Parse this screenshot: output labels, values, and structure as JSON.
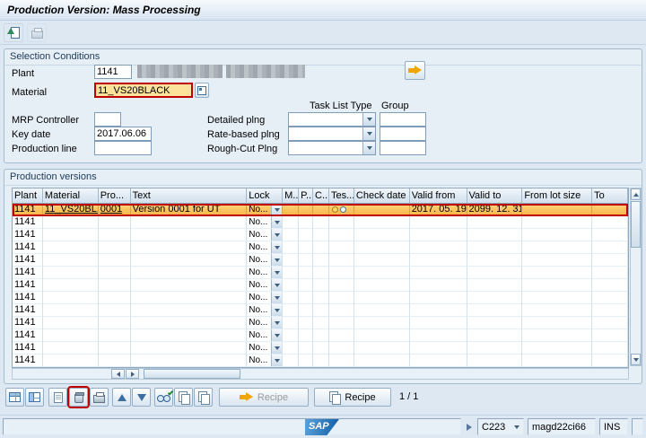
{
  "window": {
    "title": "Production Version: Mass Processing"
  },
  "selection": {
    "title": "Selection Conditions",
    "plant": {
      "label": "Plant",
      "value": "1141"
    },
    "material": {
      "label": "Material",
      "value": "11_VS20BLACK"
    },
    "col_headers": {
      "task_list_type": "Task List Type",
      "group": "Group"
    },
    "mrp": {
      "label": "MRP Controller"
    },
    "detailed": {
      "label": "Detailed plng"
    },
    "key_date": {
      "label": "Key date",
      "value": "2017.06.06"
    },
    "rate": {
      "label": "Rate-based plng"
    },
    "prod_line": {
      "label": "Production line"
    },
    "rough": {
      "label": "Rough-Cut Plng"
    }
  },
  "versions": {
    "title": "Production versions",
    "lock_display": "No...",
    "columns": [
      {
        "key": "plant",
        "label": "Plant"
      },
      {
        "key": "material",
        "label": "Material"
      },
      {
        "key": "pro",
        "label": "Pro..."
      },
      {
        "key": "text",
        "label": "Text"
      },
      {
        "key": "lock",
        "label": "Lock"
      },
      {
        "key": "m",
        "label": "M..."
      },
      {
        "key": "p",
        "label": "P..."
      },
      {
        "key": "c",
        "label": "C..."
      },
      {
        "key": "tes",
        "label": "Tes..."
      },
      {
        "key": "check_date",
        "label": "Check date"
      },
      {
        "key": "valid_from",
        "label": "Valid from"
      },
      {
        "key": "valid_to",
        "label": "Valid to"
      },
      {
        "key": "from_lot",
        "label": "From lot size"
      },
      {
        "key": "to_lot",
        "label": "To"
      }
    ],
    "rows": [
      {
        "selected": true,
        "plant": "1141",
        "material": "11_VS20BL..",
        "pro": "0001",
        "text": "Version 0001 for UT",
        "valid_from": "2017. 05. 19",
        "valid_to": "2099. 12. 31"
      },
      {
        "plant": "1141"
      },
      {
        "plant": "1141"
      },
      {
        "plant": "1141"
      },
      {
        "plant": "1141"
      },
      {
        "plant": "1141"
      },
      {
        "plant": "1141"
      },
      {
        "plant": "1141"
      },
      {
        "plant": "1141"
      },
      {
        "plant": "1141"
      },
      {
        "plant": "1141"
      },
      {
        "plant": "1141"
      },
      {
        "plant": "1141"
      }
    ]
  },
  "footer": {
    "recipe_goto": "Recipe",
    "recipe_copy": "Recipe",
    "page": "1  /  1"
  },
  "statusbar": {
    "system": "C223",
    "host": "magd22ci66",
    "mode": "INS"
  }
}
